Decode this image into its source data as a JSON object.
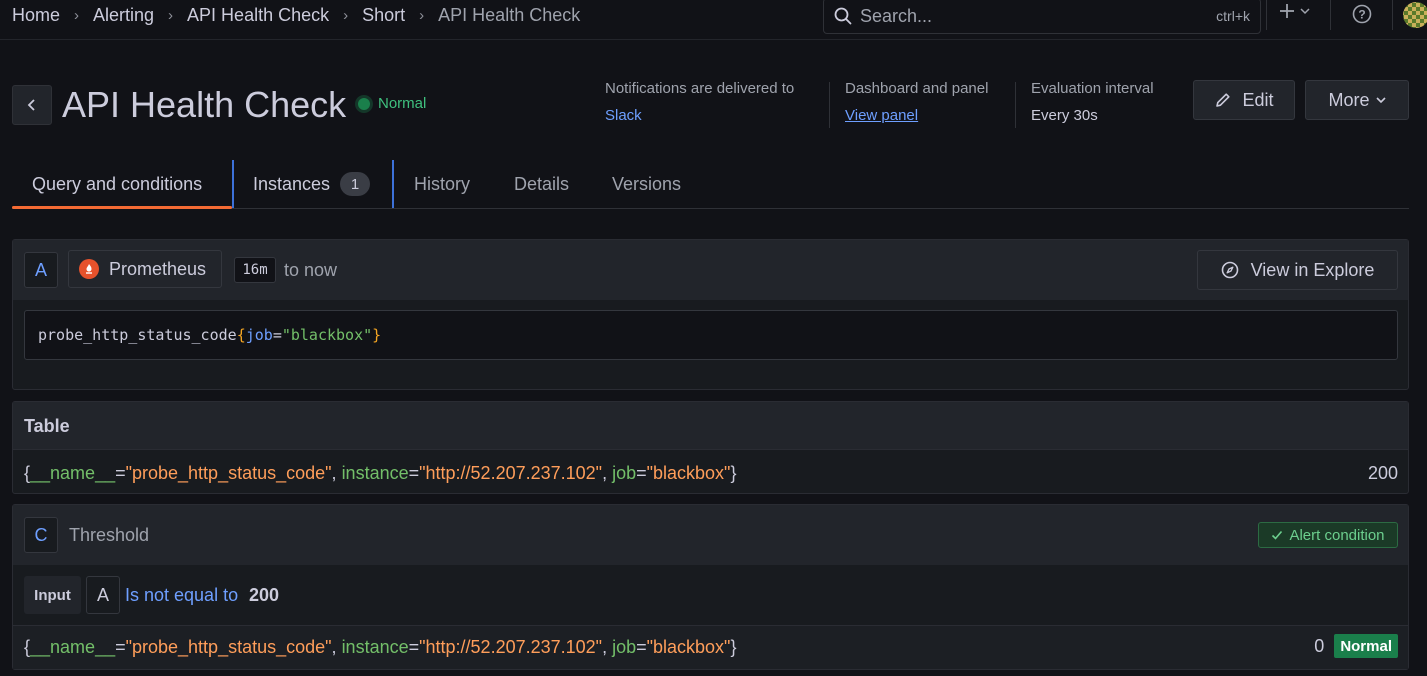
{
  "breadcrumb": {
    "items": [
      "Home",
      "Alerting",
      "API Health Check",
      "Short"
    ],
    "current": "API Health Check"
  },
  "search": {
    "placeholder": "Search...",
    "shortcut": "ctrl+k"
  },
  "header": {
    "title": "API Health Check",
    "state": "Normal",
    "notifications_label": "Notifications are delivered to",
    "notifications_value": "Slack",
    "dashboard_label": "Dashboard and panel",
    "dashboard_value": "View panel",
    "interval_label": "Evaluation interval",
    "interval_value": "Every 30s",
    "edit_label": "Edit",
    "more_label": "More"
  },
  "tabs": {
    "query": "Query and conditions",
    "instances": "Instances",
    "instances_count": "1",
    "history": "History",
    "details": "Details",
    "versions": "Versions"
  },
  "query_panel": {
    "ref_id": "A",
    "datasource": "Prometheus",
    "range": "16m",
    "range_to": "to now",
    "explore_label": "View in Explore",
    "metric": "probe_http_status_code",
    "label_key": "job",
    "label_value": "\"blackbox\""
  },
  "table_panel": {
    "title": "Table",
    "series": {
      "name_key": "__name__",
      "name_value": "\"probe_http_status_code\"",
      "instance_key": "instance",
      "instance_value": "\"http://52.207.237.102\"",
      "job_key": "job",
      "job_value": "\"blackbox\""
    },
    "value": "200"
  },
  "threshold_panel": {
    "ref_id": "C",
    "title": "Threshold",
    "alert_condition_label": "Alert condition",
    "input_label": "Input",
    "input_ref": "A",
    "operator": "Is not equal to",
    "threshold_value": "200",
    "result_value": "0",
    "result_state": "Normal"
  },
  "colors": {
    "accent_orange": "#f56b34",
    "link_blue": "#6e9fff",
    "ok_green": "#1a7f4b",
    "label_key_green": "#73bf69",
    "label_value_orange": "#ff9e5a"
  }
}
